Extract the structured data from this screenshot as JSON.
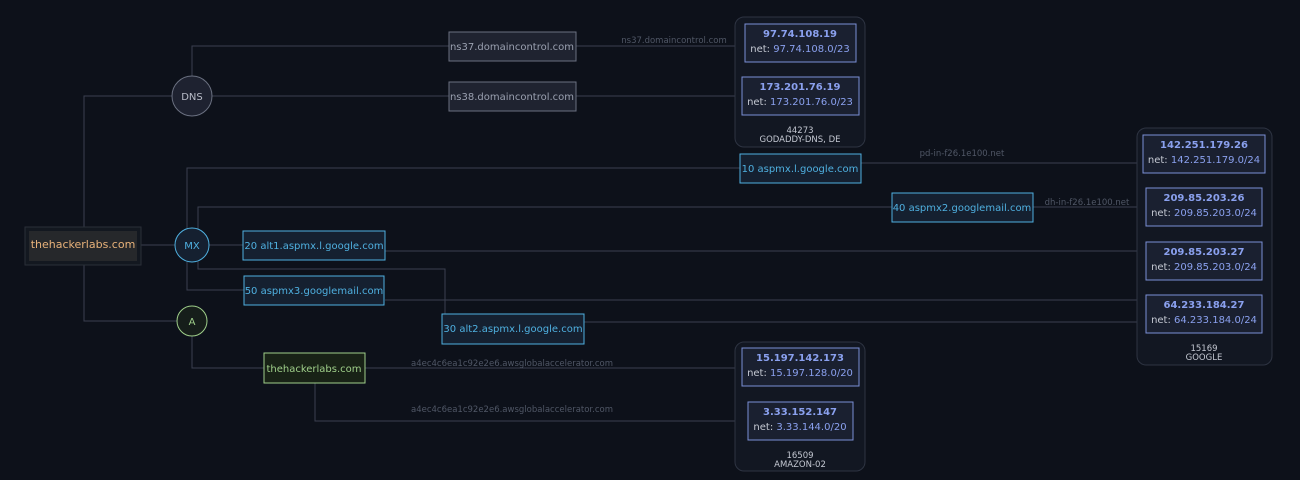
{
  "domain": "thehackerlabs.com",
  "record_types": {
    "dns": "DNS",
    "mx": "MX",
    "a": "A"
  },
  "nameservers": [
    "ns37.domaincontrol.com",
    "ns38.domaincontrol.com"
  ],
  "ns_edge_label": "ns37.domaincontrol.com",
  "mx_records": [
    "10 aspmx.l.google.com",
    "40 aspmx2.googlemail.com",
    "20 alt1.aspmx.l.google.com",
    "50 aspmx3.googlemail.com",
    "30 alt2.aspmx.l.google.com"
  ],
  "mx_edge_labels": [
    "pd-in-f26.1e100.net",
    "dh-in-f26.1e100.net"
  ],
  "a_record": "thehackerlabs.com",
  "a_edge_labels": [
    "a4ec4c6ea1c92e2e6.awsglobalaccelerator.com",
    "a4ec4c6ea1c92e2e6.awsglobalaccelerator.com"
  ],
  "net_prefix": "net:",
  "asns": [
    {
      "asn": "44273",
      "name": "GODADDY-DNS, DE",
      "ips": [
        {
          "ip": "97.74.108.19",
          "net": "97.74.108.0/23"
        },
        {
          "ip": "173.201.76.19",
          "net": "173.201.76.0/23"
        }
      ]
    },
    {
      "asn": "15169",
      "name": "GOOGLE",
      "ips": [
        {
          "ip": "142.251.179.26",
          "net": "142.251.179.0/24"
        },
        {
          "ip": "209.85.203.26",
          "net": "209.85.203.0/24"
        },
        {
          "ip": "209.85.203.27",
          "net": "209.85.203.0/24"
        },
        {
          "ip": "64.233.184.27",
          "net": "64.233.184.0/24"
        }
      ]
    },
    {
      "asn": "16509",
      "name": "AMAZON-02",
      "ips": [
        {
          "ip": "15.197.142.173",
          "net": "15.197.128.0/20"
        },
        {
          "ip": "3.33.152.147",
          "net": "3.33.144.0/20"
        }
      ]
    }
  ],
  "colors": {
    "background": "#0d111a",
    "edge": "#3a4050",
    "domain_text": "#e8b27a",
    "mx_accent": "#4fb0e0",
    "a_accent": "#9fcf8a",
    "ip_text": "#8aa0ee",
    "muted_text": "#9aa0b0"
  }
}
